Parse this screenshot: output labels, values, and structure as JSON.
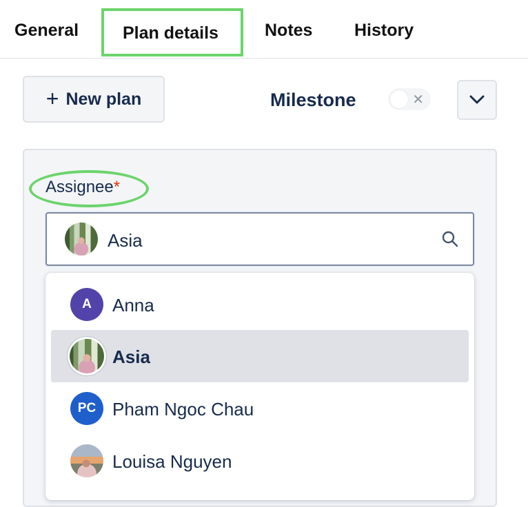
{
  "tabs": [
    {
      "label": "General"
    },
    {
      "label": "Plan details"
    },
    {
      "label": "Notes"
    },
    {
      "label": "History"
    }
  ],
  "toolbar": {
    "new_plan_label": "New plan",
    "milestone_label": "Milestone",
    "milestone_enabled": false
  },
  "form": {
    "assignee_label": "Assignee",
    "required_marker": "*",
    "assignee_value": "Asia"
  },
  "dropdown": {
    "options": [
      {
        "label": "Anna",
        "avatar": "A",
        "avatar_color": "#5243aa",
        "selected": false
      },
      {
        "label": "Asia",
        "avatar": "photo",
        "selected": true
      },
      {
        "label": "Pham Ngoc Chau",
        "avatar": "PC",
        "avatar_color": "#1f5fcc",
        "selected": false
      },
      {
        "label": "Louisa Nguyen",
        "avatar": "photo",
        "selected": false
      }
    ]
  },
  "colors": {
    "highlight": "#6cd46c",
    "selected_row": "#dfe1e6",
    "text": "#172b4d",
    "required": "#de350b"
  },
  "icons": [
    "plus-icon",
    "close-icon",
    "chevron-down-icon",
    "search-icon"
  ]
}
